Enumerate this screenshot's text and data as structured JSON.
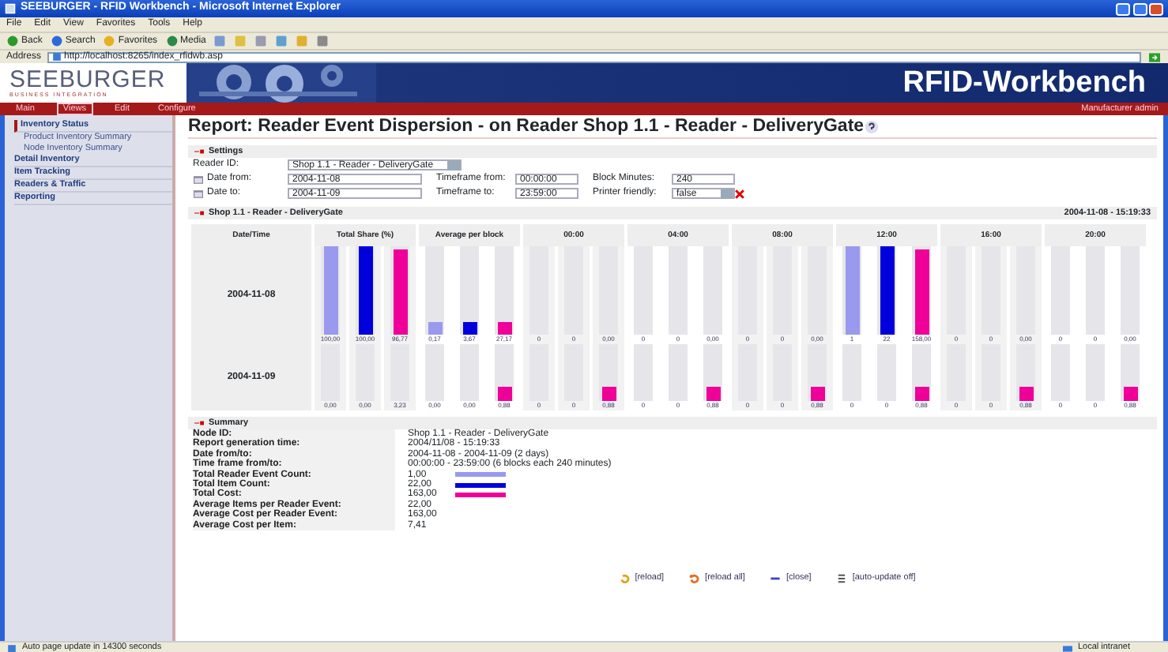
{
  "window": {
    "title": "SEEBURGER - RFID Workbench - Microsoft Internet Explorer"
  },
  "menu": [
    "File",
    "Edit",
    "View",
    "Favorites",
    "Tools",
    "Help"
  ],
  "toolbar": [
    "Back",
    "Search",
    "Favorites",
    "Media"
  ],
  "address": {
    "label": "Address",
    "value": "http://localhost:8265/index_rfidwb.asp"
  },
  "header": {
    "logo": "SEEBURGER",
    "tagline": "BUSINESS INTEGRATION",
    "product": "RFID-Workbench"
  },
  "nav": {
    "items": [
      {
        "label": "Main",
        "selected": false
      },
      {
        "label": "Views",
        "selected": true
      },
      {
        "label": "Edit",
        "selected": false
      },
      {
        "label": "Configure",
        "selected": false
      }
    ],
    "role": "Manufacturer",
    "user": "admin"
  },
  "sidebar": {
    "items": [
      {
        "label": "Inventory Status",
        "children": [
          {
            "label": "Product Inventory Summary"
          },
          {
            "label": "Node Inventory Summary"
          }
        ]
      },
      {
        "label": "Detail Inventory"
      },
      {
        "label": "Item Tracking"
      },
      {
        "label": "Readers & Traffic"
      },
      {
        "label": "Reporting"
      }
    ]
  },
  "report": {
    "title": "Report: Reader Event Dispersion - on Reader Shop 1.1 - Reader - DeliveryGate"
  },
  "settings": {
    "title": "Settings",
    "rows": [
      [
        {
          "kind": "select",
          "label": "Reader ID:",
          "value": "Shop 1.1 - Reader - DeliveryGate"
        }
      ],
      [
        {
          "kind": "date",
          "label": "Date from:",
          "value": "2004-11-08"
        },
        {
          "kind": "text",
          "label": "Timeframe from:",
          "value": "00:00:00"
        },
        {
          "kind": "text",
          "label": "Block Minutes:",
          "value": "240"
        }
      ],
      [
        {
          "kind": "date",
          "label": "Date to:",
          "value": "2004-11-09"
        },
        {
          "kind": "text",
          "label": "Timeframe to:",
          "value": "23:59:00"
        },
        {
          "kind": "select",
          "label": "Printer friendly:",
          "value": "false",
          "clear": true
        }
      ]
    ]
  },
  "dispersion": {
    "title": "Shop 1.1 - Reader - DeliveryGate",
    "timestamp": "2004-11-08 - 15:19:33",
    "columns": [
      "Date/Time",
      "Total Share (%)",
      "Average per block",
      "00:00",
      "04:00",
      "08:00",
      "12:00",
      "16:00",
      "20:00"
    ],
    "series": [
      {
        "color": "#9999ee"
      },
      {
        "color": "#0000dd"
      },
      {
        "color": "#ee0099"
      }
    ],
    "rows": [
      {
        "date": "2004-11-08",
        "groups": [
          [
            {
              "value": "100,00",
              "level": 1
            },
            {
              "value": "100,00",
              "level": 1
            },
            {
              "value": "96,77",
              "level": 0.97
            }
          ],
          [
            {
              "value": "0,17",
              "level": 0.15
            },
            {
              "value": "3,67",
              "level": 0.15
            },
            {
              "value": "27,17",
              "level": 0.15
            }
          ],
          [
            {
              "value": "0"
            },
            {
              "value": "0"
            },
            {
              "value": "0,00"
            }
          ],
          [
            {
              "value": "0"
            },
            {
              "value": "0"
            },
            {
              "value": "0,00"
            }
          ],
          [
            {
              "value": "0"
            },
            {
              "value": "0"
            },
            {
              "value": "0,00"
            }
          ],
          [
            {
              "value": "1",
              "level": 1
            },
            {
              "value": "22",
              "level": 1
            },
            {
              "value": "158,00",
              "level": 0.97
            }
          ],
          [
            {
              "value": "0"
            },
            {
              "value": "0"
            },
            {
              "value": "0,00"
            }
          ],
          [
            {
              "value": "0"
            },
            {
              "value": "0"
            },
            {
              "value": "0,00"
            }
          ]
        ]
      },
      {
        "date": "2004-11-09",
        "groups": [
          [
            {
              "value": "0,00"
            },
            {
              "value": "0,00"
            },
            {
              "value": "3,23"
            }
          ],
          [
            {
              "value": "0,00"
            },
            {
              "value": "0,00"
            },
            {
              "value": "0,88",
              "level": 0.25
            }
          ],
          [
            {
              "value": "0"
            },
            {
              "value": "0"
            },
            {
              "value": "0,88",
              "level": 0.25
            }
          ],
          [
            {
              "value": "0"
            },
            {
              "value": "0"
            },
            {
              "value": "0,88",
              "level": 0.25
            }
          ],
          [
            {
              "value": "0"
            },
            {
              "value": "0"
            },
            {
              "value": "0,88",
              "level": 0.25
            }
          ],
          [
            {
              "value": "0"
            },
            {
              "value": "0"
            },
            {
              "value": "0,88",
              "level": 0.25
            }
          ],
          [
            {
              "value": "0"
            },
            {
              "value": "0"
            },
            {
              "value": "0,88",
              "level": 0.25
            }
          ],
          [
            {
              "value": "0"
            },
            {
              "value": "0"
            },
            {
              "value": "0,88",
              "level": 0.25
            }
          ]
        ]
      }
    ]
  },
  "summary": {
    "title": "Summary",
    "rows": [
      {
        "label": "Node ID:",
        "value": "Shop 1.1 - Reader - DeliveryGate"
      },
      {
        "label": "Report generation time:",
        "value": "2004/11/08 - 15:19:33"
      },
      {
        "label": "Date from/to:",
        "value": "2004-11-08 - 2004-11-09 (2 days)"
      },
      {
        "label": "Time frame from/to:",
        "value": "00:00:00 - 23:59:00 (6 blocks each 240 minutes)"
      },
      {
        "label": "Total Reader Event Count:",
        "value": "1,00",
        "color": "#9999ee"
      },
      {
        "label": "Total Item Count:",
        "value": "22,00",
        "color": "#0000dd"
      },
      {
        "label": "Total Cost:",
        "value": "163,00",
        "color": "#ee0099"
      },
      {
        "label": "Average Items per Reader Event:",
        "value": "22,00"
      },
      {
        "label": "Average Cost per Reader Event:",
        "value": "163,00"
      },
      {
        "label": "Average Cost per Item:",
        "value": "7,41"
      }
    ]
  },
  "actions": [
    {
      "kind": "reload",
      "label": "[reload]"
    },
    {
      "kind": "reload_all",
      "label": "[reload all]"
    },
    {
      "kind": "close",
      "label": "[close]"
    },
    {
      "kind": "auto",
      "label": "[auto-update off]"
    }
  ],
  "status_bar": {
    "text": "Auto page update in 14300 seconds",
    "zone": "Local intranet"
  }
}
